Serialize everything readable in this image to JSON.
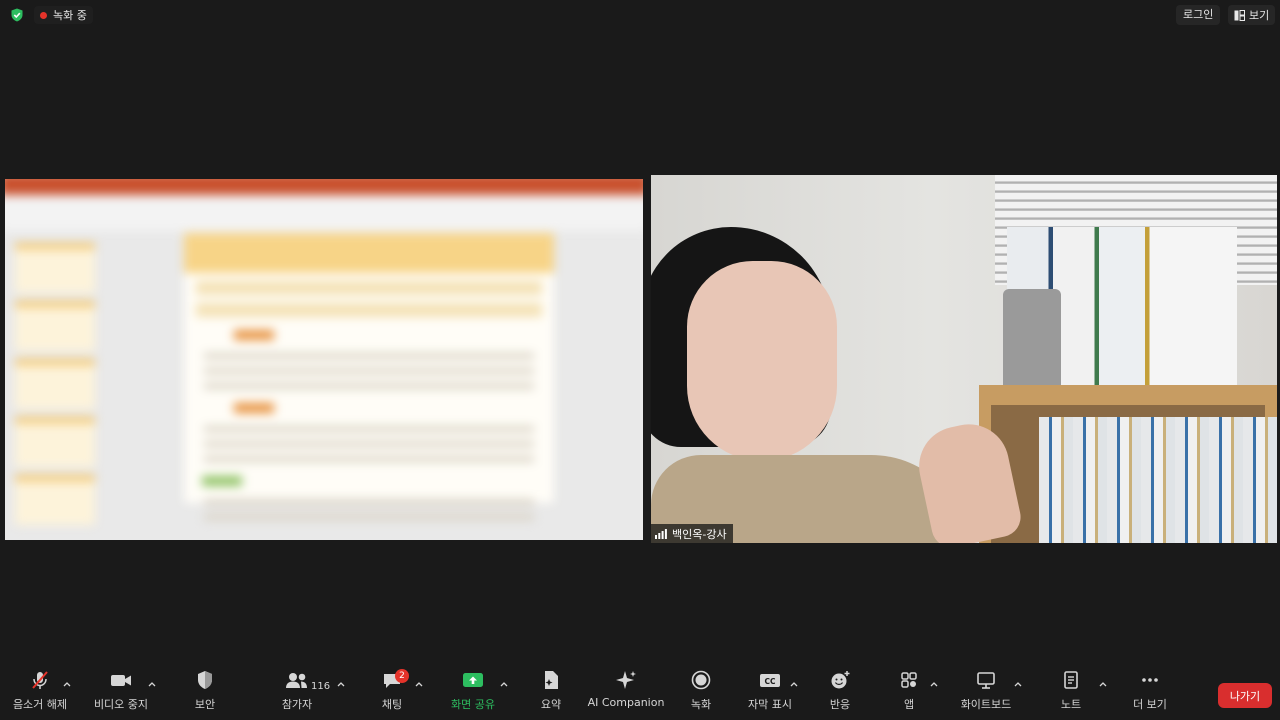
{
  "topbar": {
    "recording_label": "녹화 중",
    "login_label": "로그인",
    "view_label": "보기"
  },
  "participant": {
    "name": "백인옥-강사"
  },
  "toolbar": {
    "mute": "음소거 해제",
    "video": "비디오 중지",
    "security": "보안",
    "participants": "참가자",
    "participants_count": "116",
    "chat": "채팅",
    "chat_badge": "2",
    "share": "화면 공유",
    "summary": "요약",
    "ai": "AI Companion",
    "record": "녹화",
    "captions": "자막 표시",
    "cc_glyph": "CC",
    "reactions": "반응",
    "apps": "앱",
    "whiteboard": "화이트보드",
    "notes": "노트",
    "more": "더 보기",
    "leave": "나가기"
  },
  "colors": {
    "background": "#1a1a1a",
    "share_green": "#2dbe60",
    "leave_red": "#d92e2e",
    "record_red": "#e5332a"
  }
}
